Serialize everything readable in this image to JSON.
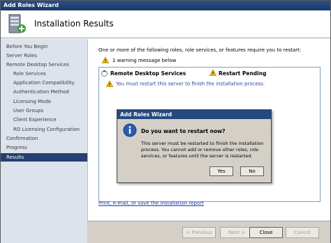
{
  "window": {
    "title": "Add Roles Wizard"
  },
  "header": {
    "title": "Installation Results"
  },
  "sidebar": {
    "items": [
      {
        "label": "Before You Begin"
      },
      {
        "label": "Server Roles"
      },
      {
        "label": "Remote Desktop Services"
      },
      {
        "label": "Role Services"
      },
      {
        "label": "Application Compatibility"
      },
      {
        "label": "Authentication Method"
      },
      {
        "label": "Licensing Mode"
      },
      {
        "label": "User Groups"
      },
      {
        "label": "Client Experience"
      },
      {
        "label": "RD Licensing Configuration"
      },
      {
        "label": "Confirmation"
      },
      {
        "label": "Progress"
      },
      {
        "label": "Results"
      }
    ]
  },
  "content": {
    "intro": "One or more of the following roles, role services, or features require you to restart:",
    "warning_count": "1 warning message below",
    "role_name": "Remote Desktop Services",
    "role_status": "Restart Pending",
    "restart_message": "You must restart this server to finish the installation process.",
    "report_link": "Print, e-mail, or save the installation report"
  },
  "footer": {
    "previous": "< Previous",
    "next": "Next >",
    "close": "Close",
    "cancel": "Cancel"
  },
  "dialog": {
    "title": "Add Roles Wizard",
    "question": "Do you want to restart now?",
    "message": "This server must be restarted to finish the installation process. You cannot add or remove other roles, role services, or features until the server is restarted.",
    "yes": "Yes",
    "no": "No"
  },
  "colors": {
    "titlebar": "#244a7f",
    "selected_nav": "#243f73",
    "link": "#1a3f9c",
    "sidebar_bg": "#dde3ec"
  },
  "icons": [
    "server-wizard-icon",
    "warning-icon",
    "collapse-icon",
    "info-icon"
  ]
}
